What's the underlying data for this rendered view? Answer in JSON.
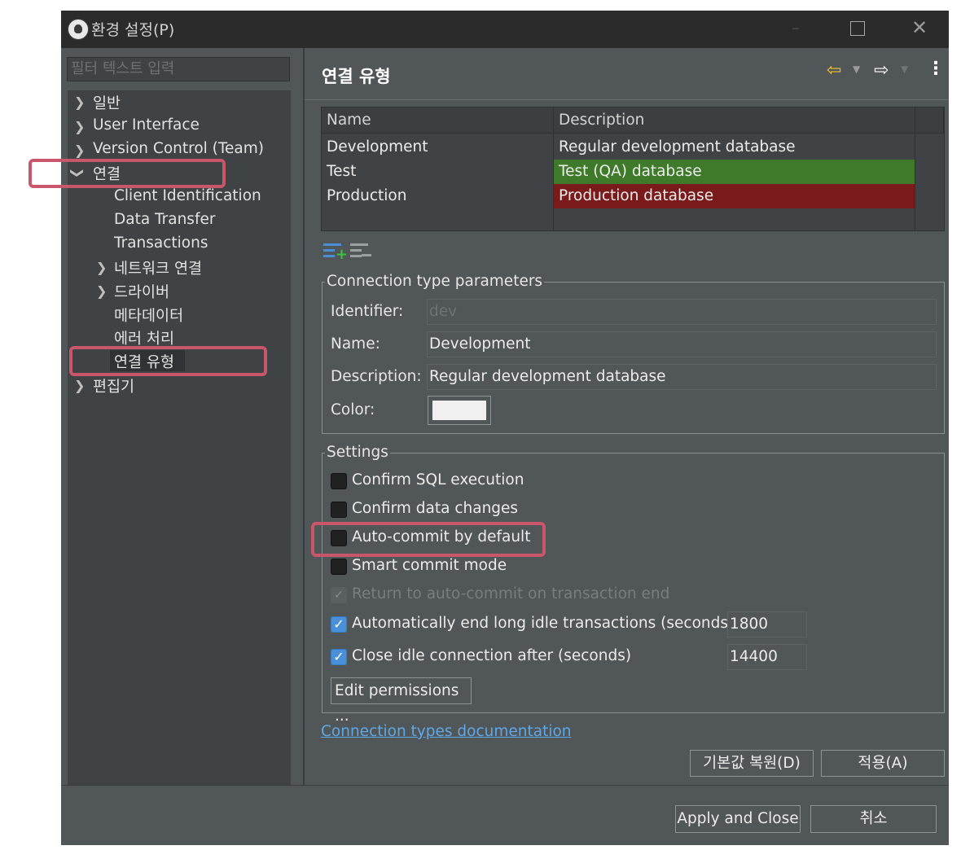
{
  "window": {
    "title": "환경 설정(P)",
    "icon": "dbeaver-beaver-icon"
  },
  "left": {
    "filter_placeholder": "필터 텍스트 입력",
    "tree": [
      {
        "label": "일반",
        "expander": "collapsed"
      },
      {
        "label": "User Interface",
        "expander": "collapsed"
      },
      {
        "label": "Version Control (Team)",
        "expander": "collapsed"
      },
      {
        "label": "연결",
        "expander": "expanded"
      },
      {
        "label": "Client Identification",
        "expander": "none"
      },
      {
        "label": "Data Transfer",
        "expander": "none"
      },
      {
        "label": "Transactions",
        "expander": "none"
      },
      {
        "label": "네트워크 연결",
        "expander": "collapsed"
      },
      {
        "label": "드라이버",
        "expander": "collapsed"
      },
      {
        "label": "메타데이터",
        "expander": "none"
      },
      {
        "label": "에러 처리",
        "expander": "none"
      },
      {
        "label": "연결 유형",
        "expander": "none",
        "selected": true
      },
      {
        "label": "편집기",
        "expander": "collapsed"
      }
    ]
  },
  "right": {
    "title": "연결 유형",
    "nav": {
      "back": "back-arrow-icon",
      "forward": "forward-arrow-icon",
      "menu": "more-vert-icon"
    },
    "table": {
      "columns": [
        "Name",
        "Description"
      ],
      "rows": [
        {
          "name": "Development",
          "description": "Regular development database",
          "color": ""
        },
        {
          "name": "Test",
          "description": "Test (QA) database",
          "color": "#3e7a2a"
        },
        {
          "name": "Production",
          "description": "Production database",
          "color": "#7a1a1a"
        }
      ]
    },
    "table_tools": {
      "add": "add-type-icon",
      "remove": "remove-type-icon"
    },
    "params": {
      "group_label": "Connection type parameters",
      "identifier_label": "Identifier:",
      "identifier_value": "dev",
      "name_label": "Name:",
      "name_value": "Development",
      "description_label": "Description:",
      "description_value": "Regular development database",
      "color_label": "Color:",
      "color_value": "#ffffff"
    },
    "settings": {
      "group_label": "Settings",
      "confirm_sql": {
        "label": "Confirm SQL execution",
        "checked": false
      },
      "confirm_data": {
        "label": "Confirm data changes",
        "checked": false
      },
      "auto_commit": {
        "label": "Auto-commit by default",
        "checked": false
      },
      "smart_commit": {
        "label": "Smart commit mode",
        "checked": false
      },
      "return_auto": {
        "label": "Return to auto-commit on transaction end",
        "checked": true,
        "disabled": true
      },
      "auto_end": {
        "label": "Automatically end long idle transactions (seconds)",
        "checked": true,
        "value": "1800"
      },
      "close_idle": {
        "label": "Close idle connection after (seconds)",
        "checked": true,
        "value": "14400"
      },
      "edit_permissions": "Edit permissions ..."
    },
    "doc_link": "Connection types documentation",
    "restore_defaults": "기본값 복원(D)",
    "apply": "적용(A)"
  },
  "footer": {
    "apply_close": "Apply and Close",
    "cancel": "취소"
  }
}
